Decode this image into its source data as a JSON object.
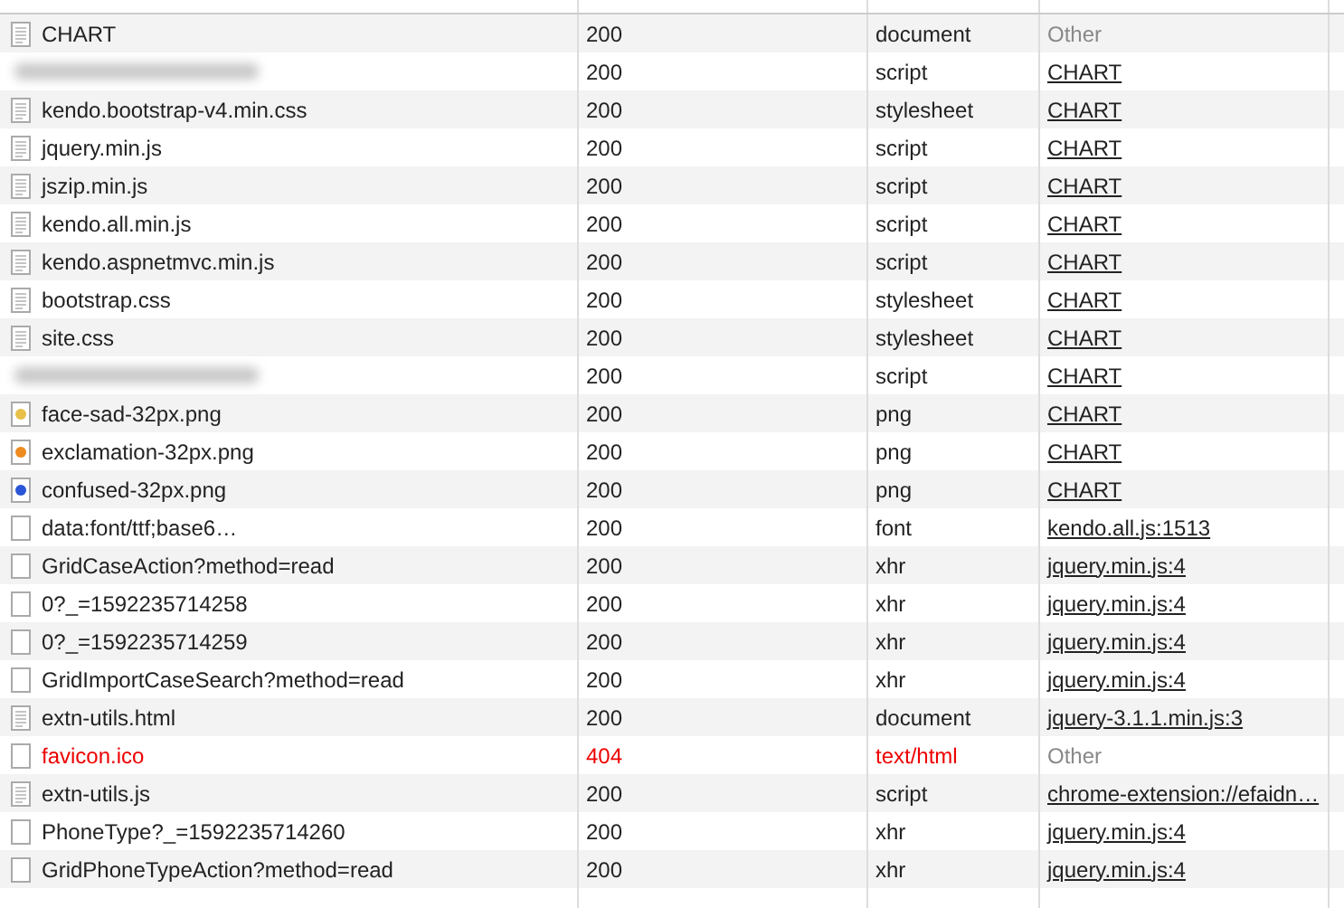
{
  "rows": [
    {
      "name": "CHART",
      "redacted": false,
      "kind": "doc",
      "status": "200",
      "type": "document",
      "initiator": "Other",
      "initiator_link": false,
      "error": false
    },
    {
      "redacted": true,
      "kind": "none",
      "status": "200",
      "type": "script",
      "initiator": "CHART",
      "initiator_link": true,
      "error": false
    },
    {
      "name": "kendo.bootstrap-v4.min.css",
      "redacted": false,
      "kind": "doc",
      "status": "200",
      "type": "stylesheet",
      "initiator": "CHART",
      "initiator_link": true,
      "error": false
    },
    {
      "name": "jquery.min.js",
      "redacted": false,
      "kind": "doc",
      "status": "200",
      "type": "script",
      "initiator": "CHART",
      "initiator_link": true,
      "error": false
    },
    {
      "name": "jszip.min.js",
      "redacted": false,
      "kind": "doc",
      "status": "200",
      "type": "script",
      "initiator": "CHART",
      "initiator_link": true,
      "error": false
    },
    {
      "name": "kendo.all.min.js",
      "redacted": false,
      "kind": "doc",
      "status": "200",
      "type": "script",
      "initiator": "CHART",
      "initiator_link": true,
      "error": false
    },
    {
      "name": "kendo.aspnetmvc.min.js",
      "redacted": false,
      "kind": "doc",
      "status": "200",
      "type": "script",
      "initiator": "CHART",
      "initiator_link": true,
      "error": false
    },
    {
      "name": "bootstrap.css",
      "redacted": false,
      "kind": "doc",
      "status": "200",
      "type": "stylesheet",
      "initiator": "CHART",
      "initiator_link": true,
      "error": false
    },
    {
      "name": "site.css",
      "redacted": false,
      "kind": "doc",
      "status": "200",
      "type": "stylesheet",
      "initiator": "CHART",
      "initiator_link": true,
      "error": false
    },
    {
      "redacted": true,
      "kind": "none",
      "status": "200",
      "type": "script",
      "initiator": "CHART",
      "initiator_link": true,
      "error": false
    },
    {
      "name": "face-sad-32px.png",
      "redacted": false,
      "kind": "image",
      "color": "#e8c04a",
      "status": "200",
      "type": "png",
      "initiator": "CHART",
      "initiator_link": true,
      "error": false
    },
    {
      "name": "exclamation-32px.png",
      "redacted": false,
      "kind": "image",
      "color": "#ee8a1e",
      "status": "200",
      "type": "png",
      "initiator": "CHART",
      "initiator_link": true,
      "error": false
    },
    {
      "name": "confused-32px.png",
      "redacted": false,
      "kind": "image",
      "color": "#2a55d8",
      "status": "200",
      "type": "png",
      "initiator": "CHART",
      "initiator_link": true,
      "error": false
    },
    {
      "name": "data:font/ttf;base6…",
      "redacted": false,
      "kind": "blank",
      "status": "200",
      "type": "font",
      "initiator": "kendo.all.js:1513",
      "initiator_link": true,
      "error": false
    },
    {
      "name": "GridCaseAction?method=read",
      "redacted": false,
      "kind": "blank",
      "status": "200",
      "type": "xhr",
      "initiator": "jquery.min.js:4",
      "initiator_link": true,
      "error": false
    },
    {
      "name": "0?_=1592235714258",
      "redacted": false,
      "kind": "blank",
      "status": "200",
      "type": "xhr",
      "initiator": "jquery.min.js:4",
      "initiator_link": true,
      "error": false
    },
    {
      "name": "0?_=1592235714259",
      "redacted": false,
      "kind": "blank",
      "status": "200",
      "type": "xhr",
      "initiator": "jquery.min.js:4",
      "initiator_link": true,
      "error": false
    },
    {
      "name": "GridImportCaseSearch?method=read",
      "redacted": false,
      "kind": "blank",
      "status": "200",
      "type": "xhr",
      "initiator": "jquery.min.js:4",
      "initiator_link": true,
      "error": false
    },
    {
      "name": "extn-utils.html",
      "redacted": false,
      "kind": "doc",
      "status": "200",
      "type": "document",
      "initiator": "jquery-3.1.1.min.js:3",
      "initiator_link": true,
      "error": false
    },
    {
      "name": "favicon.ico",
      "redacted": false,
      "kind": "blank",
      "status": "404",
      "type": "text/html",
      "initiator": "Other",
      "initiator_link": false,
      "error": true
    },
    {
      "name": "extn-utils.js",
      "redacted": false,
      "kind": "doc",
      "status": "200",
      "type": "script",
      "initiator": "chrome-extension://efaidn…",
      "initiator_link": true,
      "error": false
    },
    {
      "name": "PhoneType?_=1592235714260",
      "redacted": false,
      "kind": "blank",
      "status": "200",
      "type": "xhr",
      "initiator": "jquery.min.js:4",
      "initiator_link": true,
      "error": false
    },
    {
      "name": "GridPhoneTypeAction?method=read",
      "redacted": false,
      "kind": "blank",
      "status": "200",
      "type": "xhr",
      "initiator": "jquery.min.js:4",
      "initiator_link": true,
      "error": false
    }
  ]
}
